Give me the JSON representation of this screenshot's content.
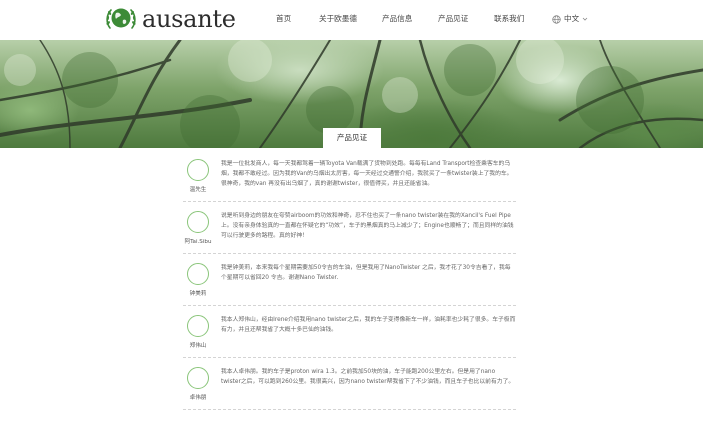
{
  "brand": {
    "name": "ausante",
    "accent": "#8ac57a",
    "logo_green": "#3d8b37"
  },
  "nav": {
    "items": [
      "首页",
      "关于欧墨德",
      "产品信息",
      "产品见证",
      "联系我们"
    ],
    "lang": "中文"
  },
  "section": {
    "title": "产品见证"
  },
  "testimonials": [
    {
      "name": "温先生",
      "text": "我是一位批发商人，每一天我都驾着一辆Toyota Van载满了货物到处跑。每每有Land Transport检查乘客车的乌烟，我都不敢经过。因为我的Van的乌烟出太厉害，每一天经过交通警介绍，我就买了一条twister装上了我的车。很神奇，我的van 再没有出乌烟了，真的谢谢twister，很值得买，并且还能省油。"
    },
    {
      "name": "阿Tai.Sibu",
      "text": "说是听到身边的朋友在夸赞airboom的功效和神奇，忍不住也买了一条nano twister装在我的Xancil's Fuel Pipe上。没有亲身体验真的一直都在怀疑它的“功效”，车子的黑烟真的马上减少了；Engine也顺畅了；而且同样的油钱可以行驶更多的路程。真的好神！"
    },
    {
      "name": "钟美莉",
      "text": "我是钟美莉，本来我每个星期需要加50令吉的车油，但是我用了NanoTwister 之后，我才花了30令吉看了，我每个星期可以省回20 令吉。谢谢Nano Twister."
    },
    {
      "name": "郑伟山",
      "text": "我本人郑伟山，经由Irene介绍我用nano twister之后，我的车子变得像新车一样，油耗率也少耗了很多。车子极而有力，并且还帮我省了大概十多巴仙的油钱。"
    },
    {
      "name": "卓伟朋",
      "text": "我本人卓伟朋。我的车子是proton wira 1.3。之前我加50块的油，车子能跑200公里左右。但是用了nano twister之后，可以跑到260公里。我很高兴，因为nano twister帮我省下了不少油钱，而且车子也比以前有力了。"
    }
  ]
}
